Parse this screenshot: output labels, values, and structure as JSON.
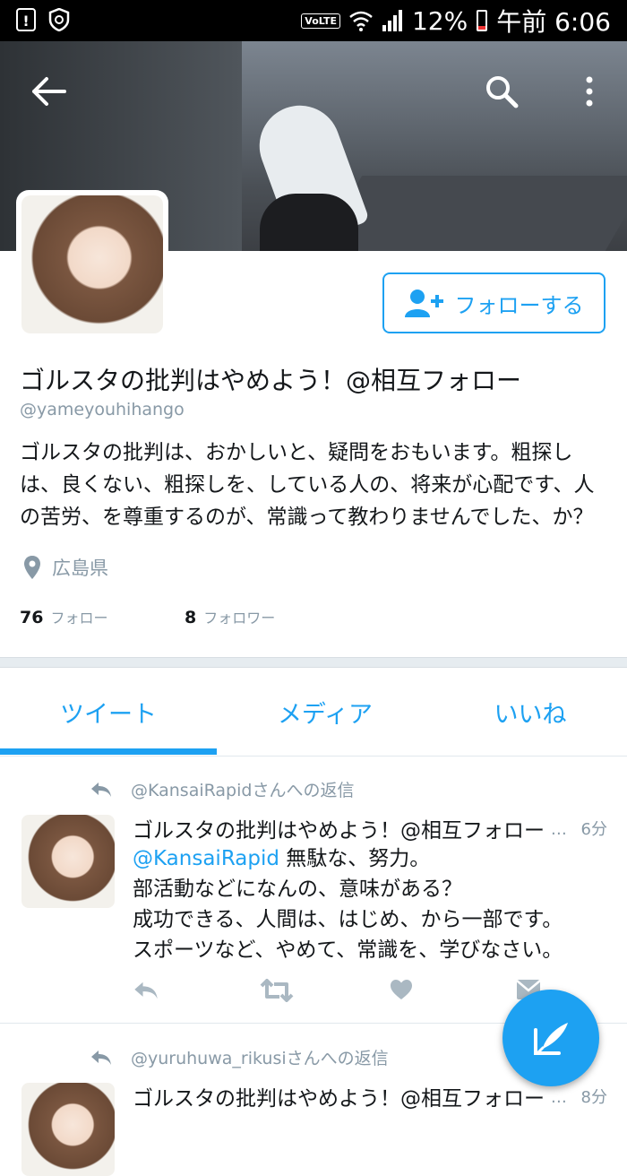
{
  "status_bar": {
    "volte": "VoLTE",
    "battery": "12%",
    "time": "午前 6:06"
  },
  "profile": {
    "follow_label": "フォローする",
    "name": "ゴルスタの批判はやめよう！@相互フォロー",
    "handle": "@yameyouhihango",
    "bio": "ゴルスタの批判は、おかしいと、疑問をおもいます。粗探しは、良くない、粗探しを、している人の、将来が心配です、人の苦労、を尊重するのが、常識って教わりませんでした、か？",
    "location": "広島県",
    "following_count": "76",
    "following_label": "フォロー",
    "followers_count": "8",
    "followers_label": "フォロワー"
  },
  "tabs": [
    {
      "label": "ツイート",
      "active": true
    },
    {
      "label": "メディア",
      "active": false
    },
    {
      "label": "いいね",
      "active": false
    }
  ],
  "tweets": [
    {
      "reply_to": "@KansaiRapidさんへの返信",
      "name": "ゴルスタの批判はやめよう！@相互フォロー",
      "ellipsis": "…",
      "time": "6分",
      "mention": "@KansaiRapid",
      "line1_rest": " 無駄な、努力。",
      "line2": "部活動などになんの、意味がある？",
      "line3": "成功できる、人間は、はじめ、から一部です。",
      "line4": "スポーツなど、やめて、常識を、学びなさい。"
    },
    {
      "reply_to": "@yuruhuwa_rikusiさんへの返信",
      "name": "ゴルスタの批判はやめよう！@相互フォロー",
      "ellipsis": "…",
      "time": "8分"
    }
  ],
  "colors": {
    "accent": "#1da1f2",
    "muted": "#8899a6",
    "text": "#14171a"
  }
}
